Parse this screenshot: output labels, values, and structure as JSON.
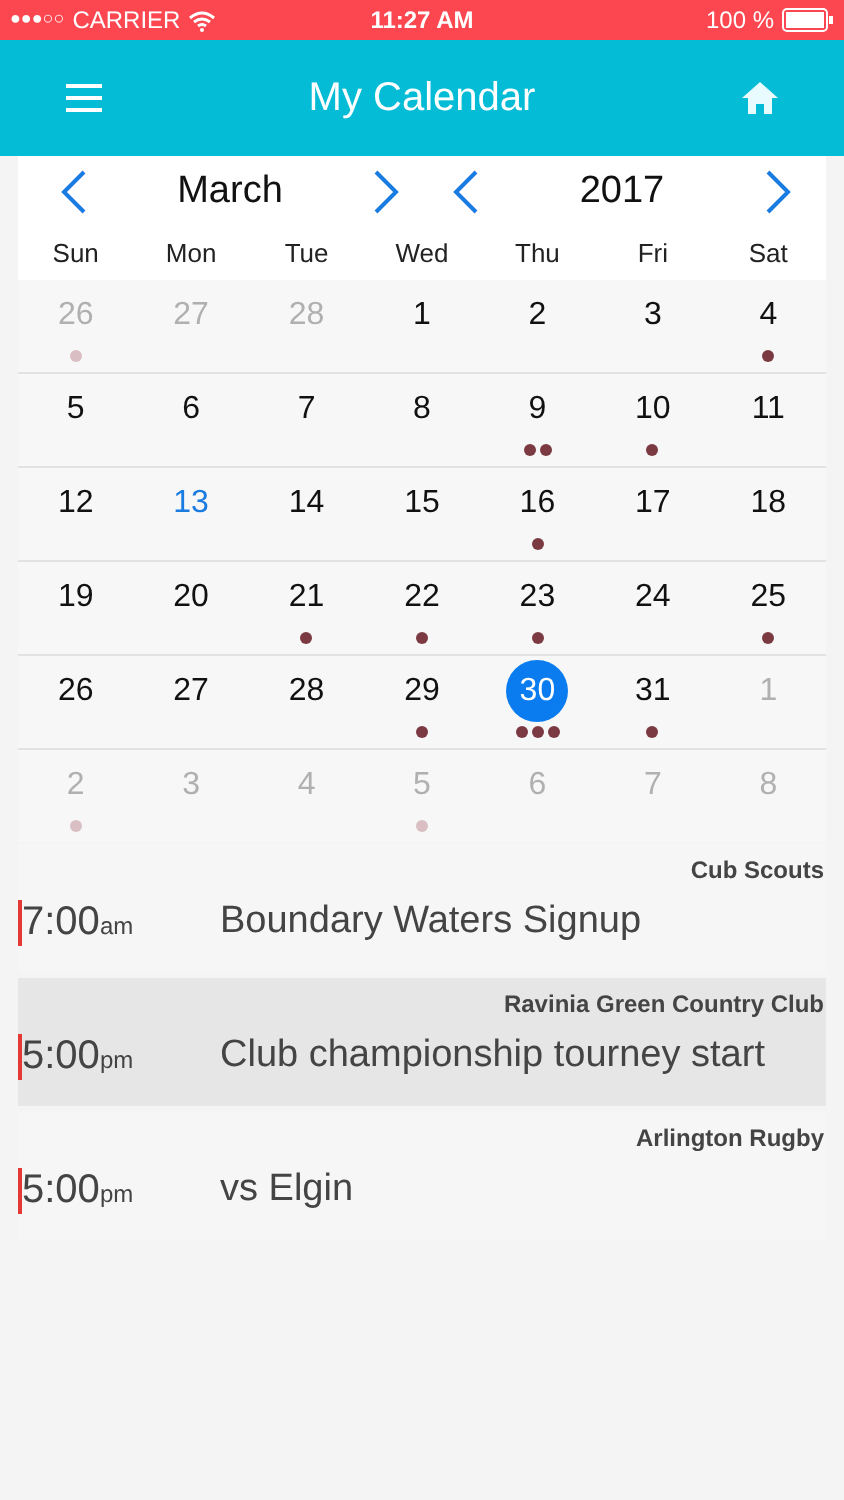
{
  "status_bar": {
    "signal": "●●●○○",
    "carrier": "CARRIER",
    "time": "11:27 AM",
    "battery": "100 %"
  },
  "header": {
    "title": "My Calendar"
  },
  "month_picker": {
    "month": "March",
    "year": "2017"
  },
  "weekdays": [
    "Sun",
    "Mon",
    "Tue",
    "Wed",
    "Thu",
    "Fri",
    "Sat"
  ],
  "weeks": [
    [
      {
        "day": "26",
        "outside": true,
        "today": false,
        "selected": false,
        "events": [
          {
            "kind": "event"
          }
        ]
      },
      {
        "day": "27",
        "outside": true,
        "today": false,
        "selected": false
      },
      {
        "day": "28",
        "outside": true,
        "today": false,
        "selected": false
      },
      {
        "day": "1",
        "outside": false,
        "today": false,
        "selected": false
      },
      {
        "day": "2",
        "outside": false,
        "today": false,
        "selected": false
      },
      {
        "day": "3",
        "outside": false,
        "today": false,
        "selected": false
      },
      {
        "day": "4",
        "outside": false,
        "today": false,
        "selected": false,
        "events": [
          {
            "kind": "event"
          }
        ]
      }
    ],
    [
      {
        "day": "5",
        "outside": false,
        "today": false,
        "selected": false
      },
      {
        "day": "6",
        "outside": false,
        "today": false,
        "selected": false
      },
      {
        "day": "7",
        "outside": false,
        "today": false,
        "selected": false
      },
      {
        "day": "8",
        "outside": false,
        "today": false,
        "selected": false
      },
      {
        "day": "9",
        "outside": false,
        "today": false,
        "selected": false,
        "events": [
          {
            "kind": "event"
          },
          {
            "kind": "event"
          }
        ]
      },
      {
        "day": "10",
        "outside": false,
        "today": false,
        "selected": false,
        "events": [
          {
            "kind": "event"
          }
        ]
      },
      {
        "day": "11",
        "outside": false,
        "today": false,
        "selected": false
      }
    ],
    [
      {
        "day": "12",
        "outside": false,
        "today": false,
        "selected": false
      },
      {
        "day": "13",
        "outside": false,
        "today": true,
        "selected": false
      },
      {
        "day": "14",
        "outside": false,
        "today": false,
        "selected": false
      },
      {
        "day": "15",
        "outside": false,
        "today": false,
        "selected": false
      },
      {
        "day": "16",
        "outside": false,
        "today": false,
        "selected": false,
        "events": [
          {
            "kind": "event"
          }
        ]
      },
      {
        "day": "17",
        "outside": false,
        "today": false,
        "selected": false
      },
      {
        "day": "18",
        "outside": false,
        "today": false,
        "selected": false
      }
    ],
    [
      {
        "day": "19",
        "outside": false,
        "today": false,
        "selected": false
      },
      {
        "day": "20",
        "outside": false,
        "today": false,
        "selected": false
      },
      {
        "day": "21",
        "outside": false,
        "today": false,
        "selected": false,
        "events": [
          {
            "kind": "event"
          }
        ]
      },
      {
        "day": "22",
        "outside": false,
        "today": false,
        "selected": false,
        "events": [
          {
            "kind": "event"
          }
        ]
      },
      {
        "day": "23",
        "outside": false,
        "today": false,
        "selected": false,
        "events": [
          {
            "kind": "event"
          }
        ]
      },
      {
        "day": "24",
        "outside": false,
        "today": false,
        "selected": false
      },
      {
        "day": "25",
        "outside": false,
        "today": false,
        "selected": false,
        "events": [
          {
            "kind": "event"
          }
        ]
      }
    ],
    [
      {
        "day": "26",
        "outside": false,
        "today": false,
        "selected": false
      },
      {
        "day": "27",
        "outside": false,
        "today": false,
        "selected": false
      },
      {
        "day": "28",
        "outside": false,
        "today": false,
        "selected": false
      },
      {
        "day": "29",
        "outside": false,
        "today": false,
        "selected": false,
        "events": [
          {
            "kind": "event"
          }
        ]
      },
      {
        "day": "30",
        "outside": false,
        "today": false,
        "selected": true,
        "events": [
          {
            "kind": "event"
          },
          {
            "kind": "event"
          },
          {
            "kind": "event"
          }
        ]
      },
      {
        "day": "31",
        "outside": false,
        "today": false,
        "selected": false,
        "events": [
          {
            "kind": "event"
          }
        ]
      },
      {
        "day": "1",
        "outside": true,
        "today": false,
        "selected": false
      }
    ],
    [
      {
        "day": "2",
        "outside": true,
        "today": false,
        "selected": false,
        "events": [
          {
            "kind": "event"
          }
        ]
      },
      {
        "day": "3",
        "outside": true,
        "today": false,
        "selected": false
      },
      {
        "day": "4",
        "outside": true,
        "today": false,
        "selected": false
      },
      {
        "day": "5",
        "outside": true,
        "today": false,
        "selected": false,
        "events": [
          {
            "kind": "event"
          }
        ]
      },
      {
        "day": "6",
        "outside": true,
        "today": false,
        "selected": false
      },
      {
        "day": "7",
        "outside": true,
        "today": false,
        "selected": false
      },
      {
        "day": "8",
        "outside": true,
        "today": false,
        "selected": false
      }
    ]
  ],
  "events": [
    {
      "group": "Cub Scouts",
      "time": "7:00",
      "meridiem": "am",
      "title": "Boundary Waters Signup",
      "selected": false
    },
    {
      "group": "Ravinia Green Country Club",
      "time": "5:00",
      "meridiem": "pm",
      "title": "Club championship tourney start",
      "selected": true
    },
    {
      "group": "Arlington Rugby",
      "time": "5:00",
      "meridiem": "pm",
      "title": "vs Elgin",
      "selected": false
    }
  ]
}
